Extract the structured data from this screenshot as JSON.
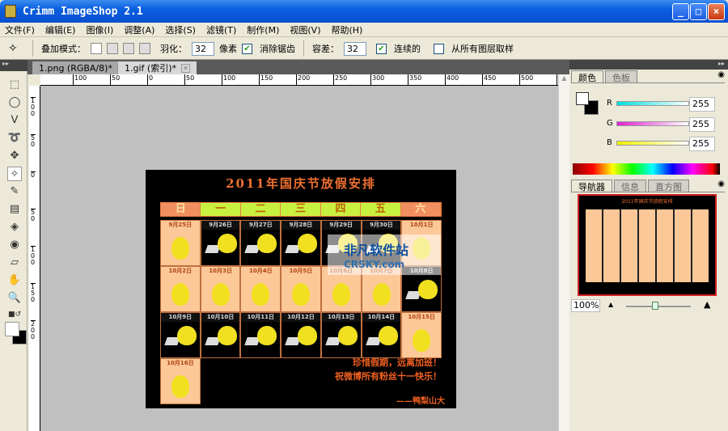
{
  "window": {
    "title": "Crimm ImageShop 2.1",
    "minimize": "_",
    "maximize": "□",
    "close": "×"
  },
  "menu": [
    "文件(F)",
    "编辑(E)",
    "图像(I)",
    "调整(A)",
    "选择(S)",
    "滤镜(T)",
    "制作(M)",
    "视图(V)",
    "帮助(H)"
  ],
  "options": {
    "blend_label": "叠加模式：",
    "feather_label": "羽化：",
    "feather_value": "32",
    "feather_unit": "像素",
    "antialias_label": "消除锯齿",
    "antialias_checked": true,
    "tolerance_label": "容差：",
    "tolerance_value": "32",
    "contiguous_label": "连续的",
    "contiguous_checked": true,
    "sample_all_label": "从所有图层取样",
    "sample_all_checked": false
  },
  "tabs": [
    {
      "label": "1.png (RGBA/8)*",
      "active": false
    },
    {
      "label": "1.gif (索引)*",
      "active": true
    }
  ],
  "ruler": {
    "h": [
      "100",
      "50",
      "0",
      "50",
      "100",
      "150",
      "200",
      "250",
      "300",
      "350",
      "400",
      "450",
      "500",
      "5"
    ],
    "v": [
      "100",
      "50",
      "0",
      "50",
      "100",
      "150",
      "200"
    ]
  },
  "image": {
    "title": "2011年国庆节放假安排",
    "weekdays": [
      "日",
      "一",
      "二",
      "三",
      "四",
      "五",
      "六"
    ],
    "cells": [
      {
        "date": "9月25日",
        "type": "rest"
      },
      {
        "date": "9月26日",
        "type": "work"
      },
      {
        "date": "9月27日",
        "type": "work"
      },
      {
        "date": "9月28日",
        "type": "work"
      },
      {
        "date": "9月29日",
        "type": "work"
      },
      {
        "date": "9月30日",
        "type": "work"
      },
      {
        "date": "10月1日",
        "type": "rest"
      },
      {
        "date": "10月2日",
        "type": "rest"
      },
      {
        "date": "10月3日",
        "type": "rest"
      },
      {
        "date": "10月4日",
        "type": "rest"
      },
      {
        "date": "10月5日",
        "type": "rest"
      },
      {
        "date": "10月6日",
        "type": "rest"
      },
      {
        "date": "10月7日",
        "type": "rest"
      },
      {
        "date": "10月8日",
        "type": "work"
      },
      {
        "date": "10月9日",
        "type": "work"
      },
      {
        "date": "10月10日",
        "type": "work"
      },
      {
        "date": "10月11日",
        "type": "work"
      },
      {
        "date": "10月12日",
        "type": "work"
      },
      {
        "date": "10月13日",
        "type": "work"
      },
      {
        "date": "10月14日",
        "type": "work"
      },
      {
        "date": "10月15日",
        "type": "rest"
      },
      {
        "date": "10月16日",
        "type": "rest"
      }
    ],
    "message1": "珍惜假期，远离加班！",
    "message2": "祝微博所有粉丝十一快乐！",
    "signature": "——鸭梨山大",
    "watermark1": "非凡软件站",
    "watermark2": "CRSKY.com"
  },
  "panel": {
    "color_tabs": [
      "颜色",
      "色板"
    ],
    "r_label": "R",
    "g_label": "G",
    "b_label": "B",
    "r": "255",
    "g": "255",
    "b": "255",
    "nav_tabs": [
      "导航器",
      "信息",
      "直方图"
    ],
    "zoom": "100%",
    "zoom_slider": 0.45
  },
  "colors": {
    "accent": "#f07030",
    "weekday_green": "#c8f040",
    "weekend": "#f09060"
  }
}
